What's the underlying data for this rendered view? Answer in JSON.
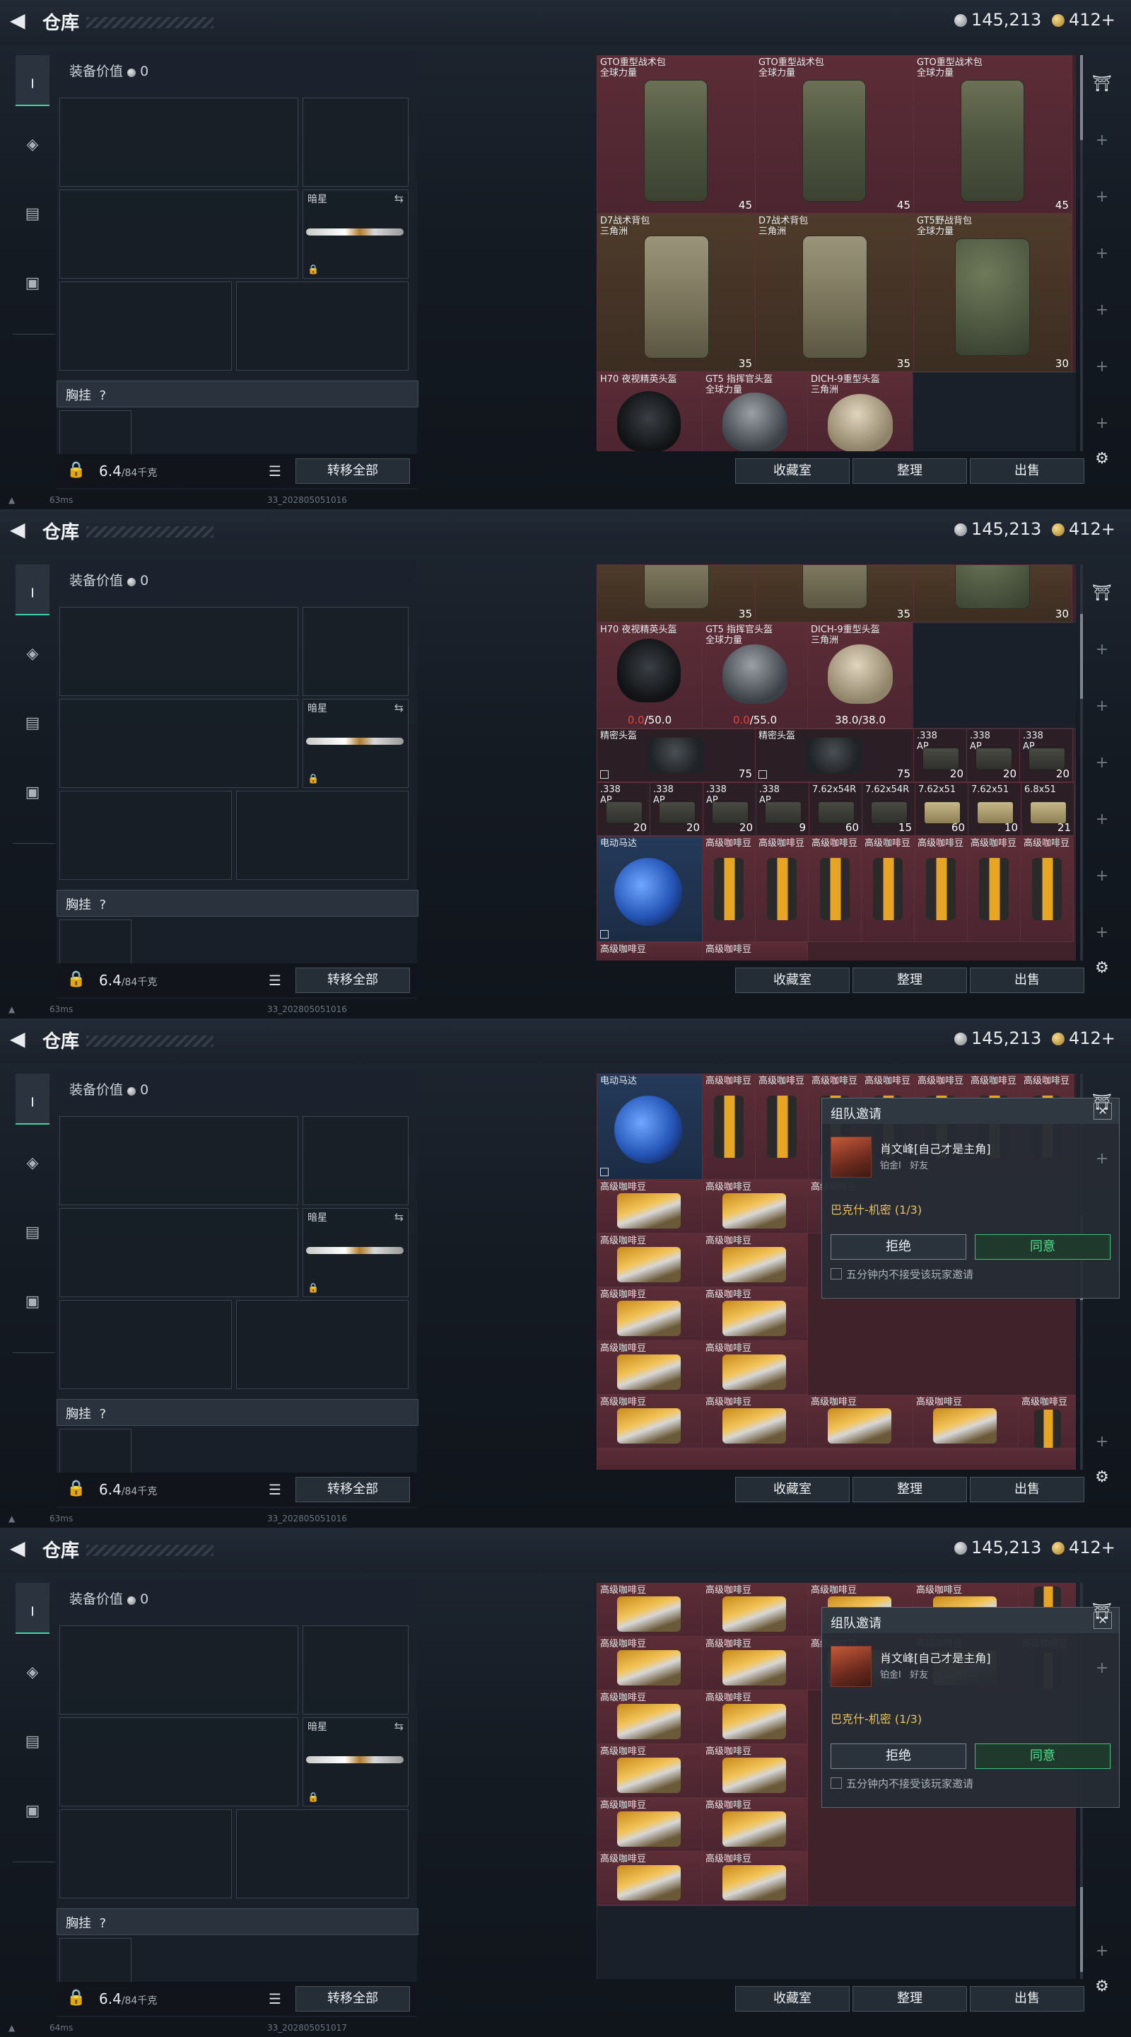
{
  "screen": {
    "title": "仓库",
    "silver": "145,213",
    "gold": "412+",
    "equip_label": "装备价值",
    "equip_value": "0",
    "knife_name": "暗星",
    "chest_label": "胸挂",
    "chest_q": "?",
    "weight": "6.4",
    "weight_max": "/84千克",
    "transfer_all": "转移全部",
    "btn_collection": "收藏室",
    "btn_sort": "整理",
    "btn_sell": "出售",
    "invite_title": "组队邀请",
    "invite_player": "肖文峰[自己才是主角]",
    "invite_rank": "铂金Ⅰ",
    "invite_friend": "好友",
    "invite_map": "巴克什-机密 (1/3)",
    "decline": "拒绝",
    "accept": "同意",
    "no_accept_5min": "五分钟内不接受该玩家邀请",
    "status": [
      {
        "ping": "63ms",
        "id": "33_202805051016"
      },
      {
        "ping": "63ms",
        "id": "33_202805051016"
      },
      {
        "ping": "63ms",
        "id": "33_202805051016"
      },
      {
        "ping": "64ms",
        "id": "33_202805051017"
      }
    ]
  },
  "items": {
    "gto_name": "GTO重型战术包",
    "gto_sub": "全球力量",
    "d7_name": "D7战术背包",
    "d7_sub": "三角洲",
    "gt5_name": "GT5野战背包",
    "gt5_sub": "全球力量",
    "h70": "H70 夜视精英头盔",
    "gt5helm": "GT5 指挥官头盔",
    "gt5helm_sub": "全球力量",
    "dich": "DICH-9重型头盔",
    "dich_sub": "三角洲",
    "jm_helm": "精密头盔",
    "motor": "电动马达",
    "coffee": "高级咖啡豆",
    "a338": ".338",
    "ap": "AP",
    "a762r": "7.62x54R",
    "a762": "7.62x51",
    "a68": "6.8x51",
    "c45": "45",
    "c35": "35",
    "c30": "30",
    "c75": "75",
    "c20": "20",
    "c9": "9",
    "c60": "60",
    "c15": "15",
    "c10": "10",
    "c21": "21",
    "dur1a": "0.0",
    "dur1b": "/50.0",
    "dur2a": "0.0",
    "dur2b": "/55.0",
    "dur3": "38.0/38.0"
  }
}
